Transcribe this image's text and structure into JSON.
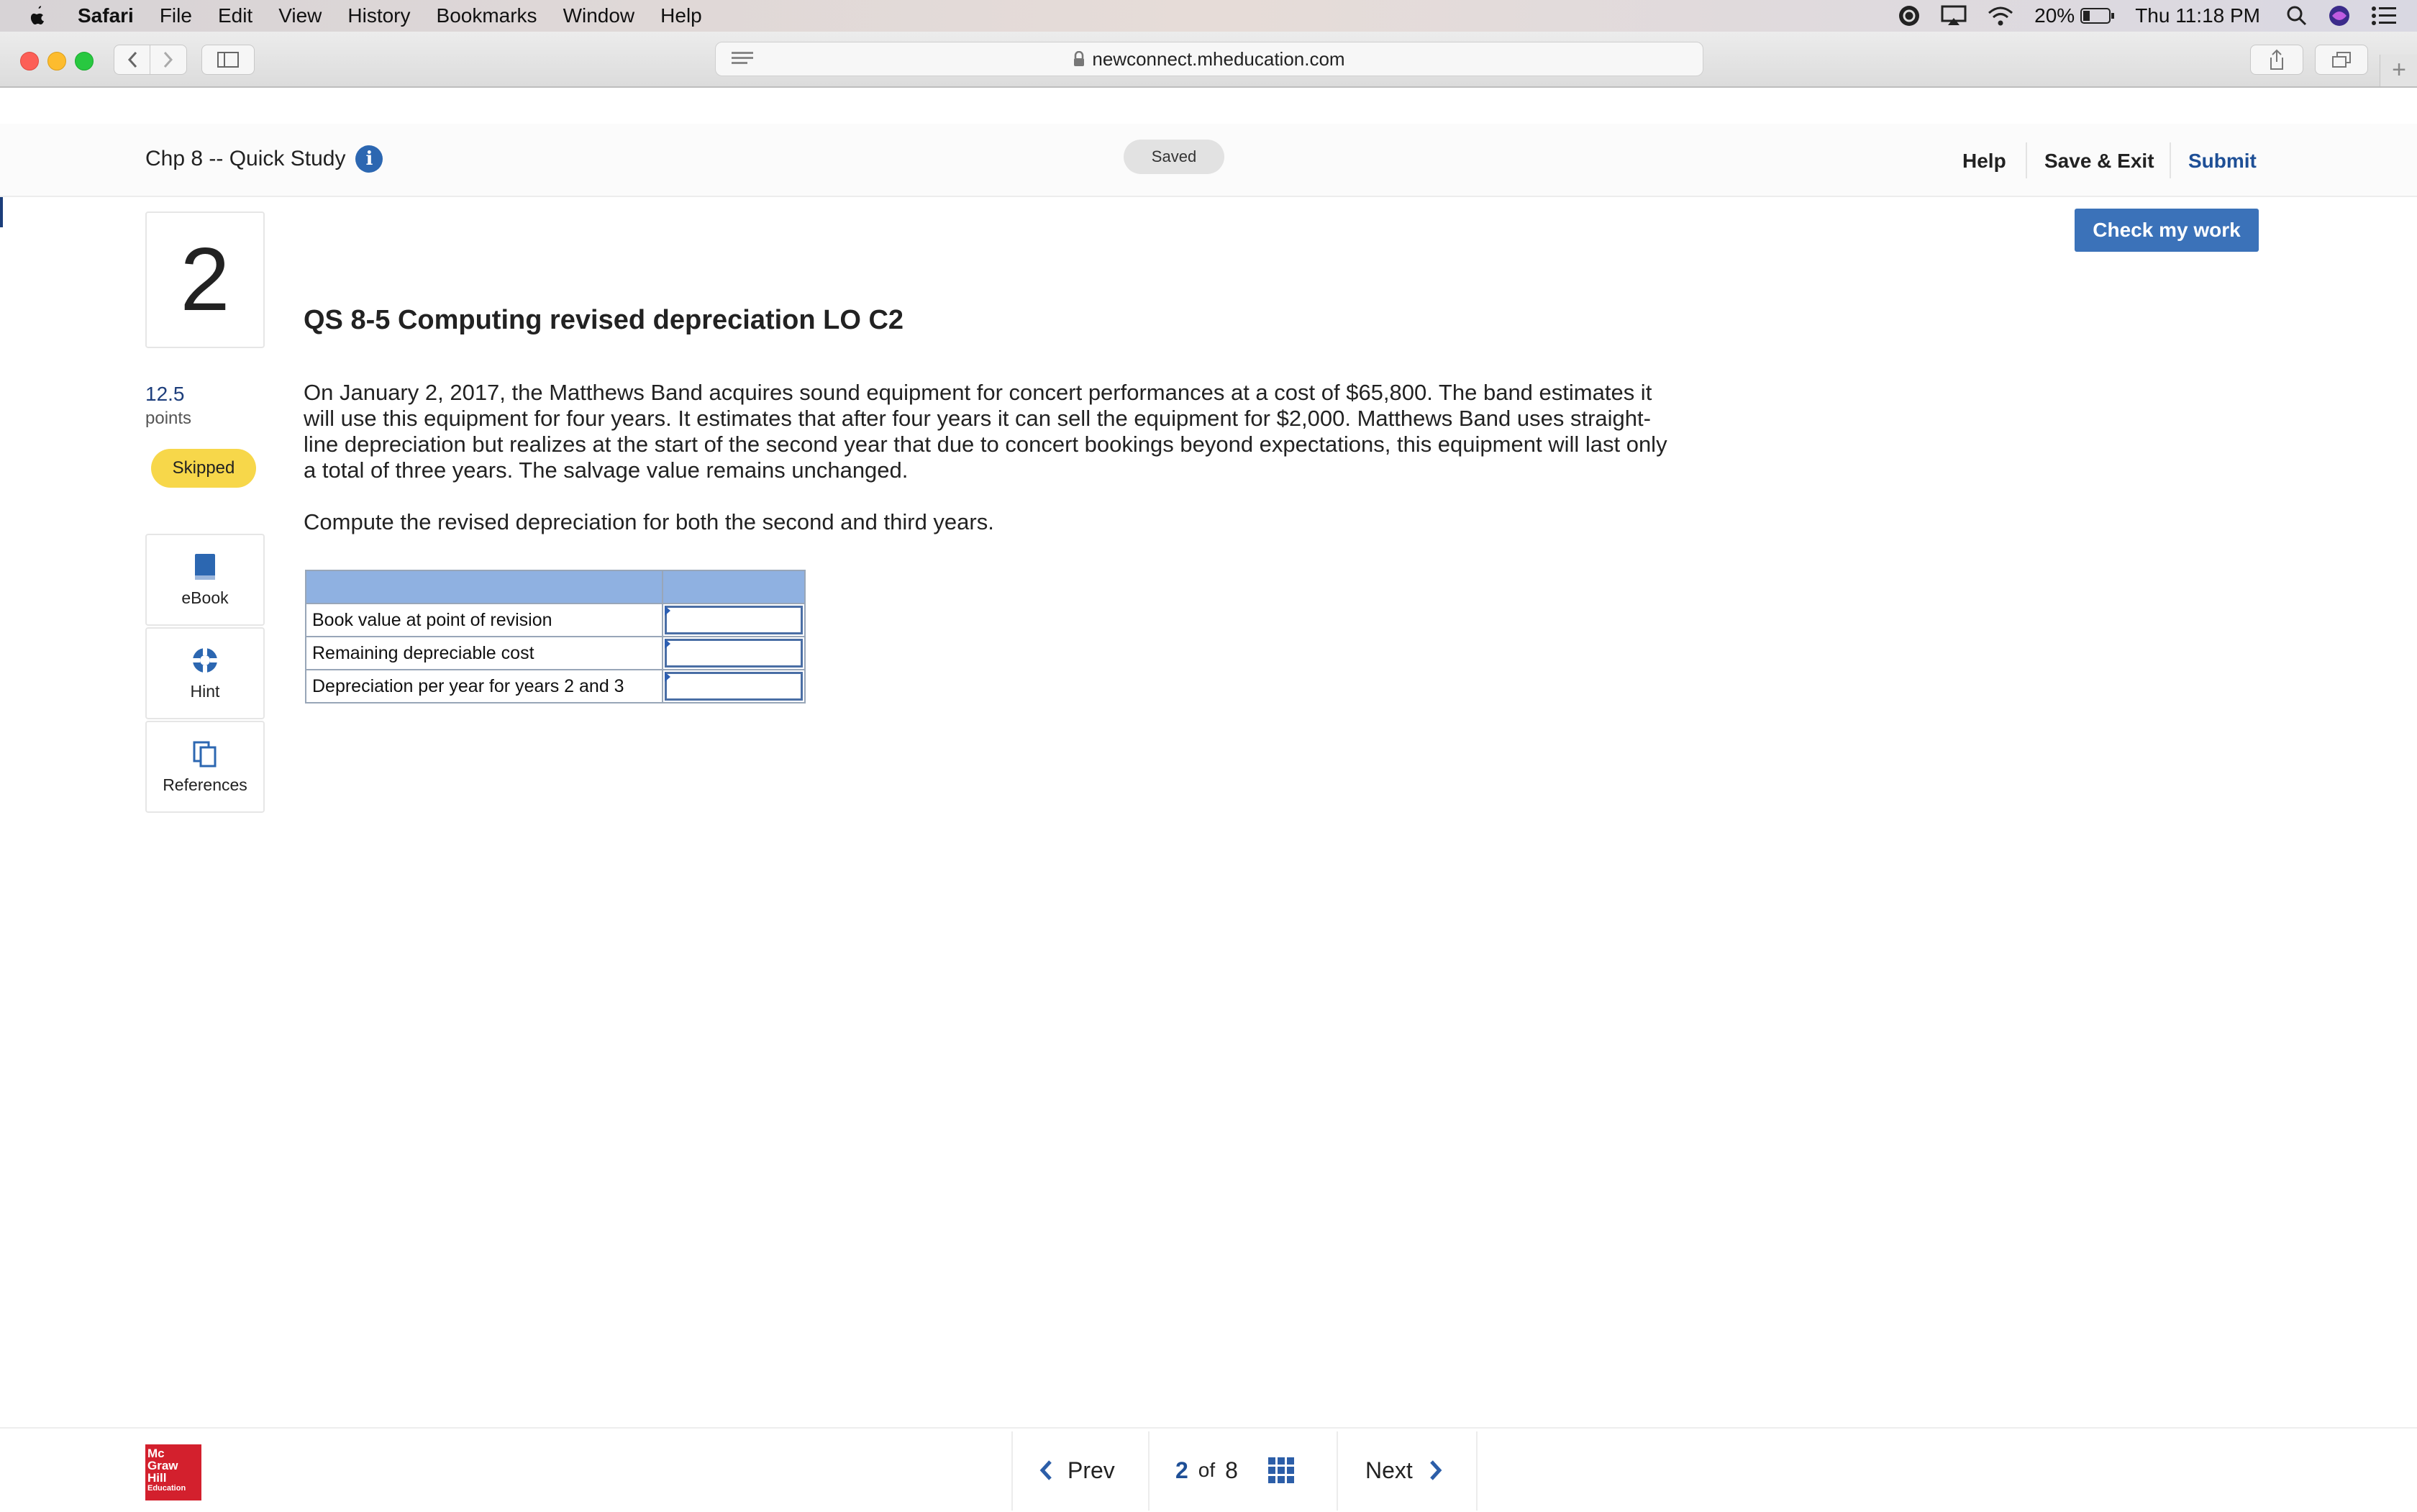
{
  "menubar": {
    "app": "Safari",
    "items": [
      "File",
      "Edit",
      "View",
      "History",
      "Bookmarks",
      "Window",
      "Help"
    ],
    "battery": "20%",
    "clock": "Thu 11:18 PM"
  },
  "browser": {
    "url": "newconnect.mheducation.com"
  },
  "header": {
    "title": "Chp 8 -- Quick Study",
    "status": "Saved",
    "help": "Help",
    "save_exit": "Save & Exit",
    "submit": "Submit"
  },
  "question": {
    "number": "2",
    "points": "12.5",
    "points_label": "points",
    "status_badge": "Skipped",
    "check_button": "Check my work",
    "title": "QS 8-5 Computing revised depreciation LO C2",
    "body": "On January 2, 2017, the Matthews Band acquires sound equipment for concert performances at a cost of $65,800. The band estimates it will use this equipment for four years. It estimates that after four years it can sell the equipment for $2,000. Matthews Band uses straight-line depreciation but realizes at the start of the second year that due to concert bookings beyond expectations, this equipment will last only a total of three years. The salvage value remains unchanged.",
    "instruction": "Compute the revised depreciation for both the second and third years.",
    "rows": [
      {
        "label": "Book value at point of revision",
        "value": ""
      },
      {
        "label": "Remaining depreciable cost",
        "value": ""
      },
      {
        "label": "Depreciation per year for years 2 and 3",
        "value": ""
      }
    ]
  },
  "tools": {
    "ebook": "eBook",
    "hint": "Hint",
    "references": "References"
  },
  "footer": {
    "logo_lines": [
      "Mc",
      "Graw",
      "Hill",
      "Education"
    ],
    "prev": "Prev",
    "current_page": "2",
    "of": "of",
    "total_pages": "8",
    "next": "Next"
  },
  "colors": {
    "brand_blue": "#3b72b9",
    "table_header": "#8fb1e1",
    "skipped_badge": "#f7d74a",
    "logo_red": "#d3202d"
  }
}
